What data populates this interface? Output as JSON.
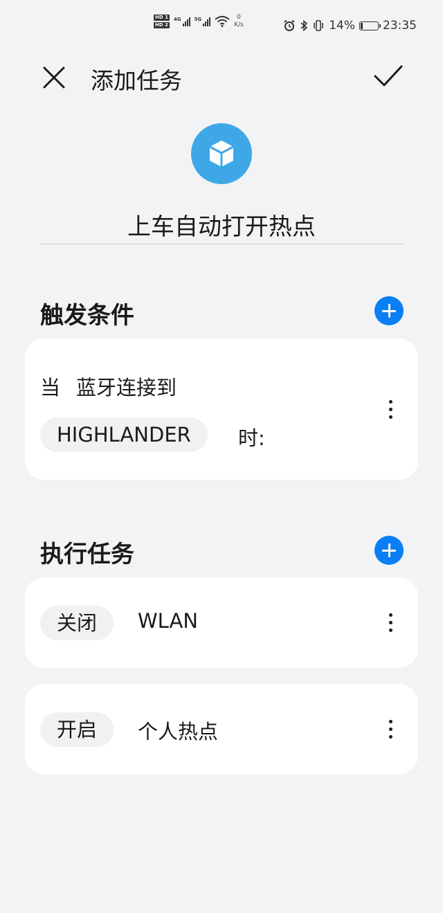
{
  "status_bar": {
    "hd1": "HD 1",
    "hd2": "HD 2",
    "sim1_type": "4G",
    "sim2_type": "5G",
    "speed_value": "0",
    "speed_unit": "K/s",
    "battery_percent": "14%",
    "battery_level": 0.14,
    "time": "23:35",
    "icons": [
      "alarm-icon",
      "bluetooth-icon",
      "vibrate-icon",
      "wifi-icon",
      "battery-icon"
    ]
  },
  "header": {
    "title": "添加任务",
    "close_icon": "close-icon",
    "confirm_icon": "checkmark-icon"
  },
  "task": {
    "icon": "cube-icon",
    "icon_color": "#3ea8e6",
    "name": "上车自动打开热点"
  },
  "trigger_section": {
    "title": "触发条件",
    "add_icon": "plus-icon",
    "condition": {
      "prefix": "当",
      "text": "蓝牙连接到",
      "device": "HIGHLANDER",
      "suffix": "时:"
    }
  },
  "action_section": {
    "title": "执行任务",
    "add_icon": "plus-icon",
    "actions": [
      {
        "state": "关闭",
        "target": "WLAN"
      },
      {
        "state": "开启",
        "target": "个人热点"
      }
    ]
  },
  "colors": {
    "accent": "#0a7ff5",
    "background": "#f1f3f5",
    "card": "#ffffff"
  }
}
